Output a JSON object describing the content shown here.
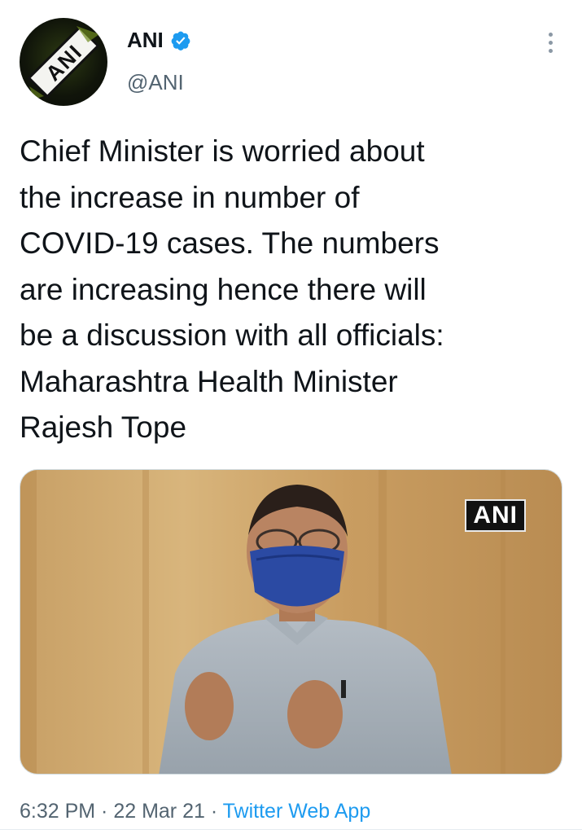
{
  "author": {
    "display_name": "ANI",
    "handle": "@ANI",
    "verified": true,
    "avatar_icon": "ani-logo-icon"
  },
  "tweet": {
    "lines": [
      "Chief Minister is worried about",
      "the increase in number of",
      "COVID-19 cases. The numbers",
      "are increasing hence there will",
      "be a discussion with all officials:",
      "Maharashtra Health Minister",
      "Rajesh Tope"
    ]
  },
  "media": {
    "watermark": "ANI"
  },
  "meta": {
    "time": "6:32 PM",
    "sep1": " · ",
    "date": "22 Mar 21",
    "sep2": " · ",
    "source": "Twitter Web App"
  },
  "colors": {
    "link": "#1d9bf0",
    "verified": "#1d9bf0",
    "secondary_text": "#536471"
  }
}
